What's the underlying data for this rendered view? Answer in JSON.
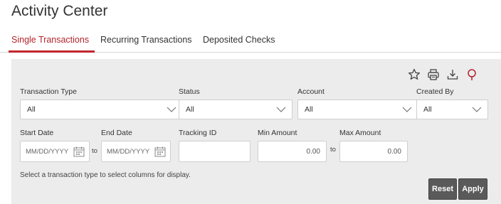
{
  "page": {
    "title": "Activity Center"
  },
  "tabs": [
    {
      "label": "Single Transactions",
      "active": true
    },
    {
      "label": "Recurring Transactions",
      "active": false
    },
    {
      "label": "Deposited Checks",
      "active": false
    }
  ],
  "toolbar": {
    "icons": [
      "star-icon",
      "print-icon",
      "download-icon",
      "search-icon"
    ]
  },
  "filters": {
    "transaction_type": {
      "label": "Transaction Type",
      "value": "All"
    },
    "status": {
      "label": "Status",
      "value": "All"
    },
    "account": {
      "label": "Account",
      "value": "All"
    },
    "created_by": {
      "label": "Created By",
      "value": "All"
    },
    "start_date": {
      "label": "Start Date",
      "placeholder": "MM/DD/YYYY"
    },
    "end_date": {
      "label": "End Date",
      "placeholder": "MM/DD/YYYY"
    },
    "date_range_separator": "to",
    "tracking_id": {
      "label": "Tracking ID",
      "value": ""
    },
    "min_amount": {
      "label": "Min Amount",
      "value": "0.00"
    },
    "max_amount": {
      "label": "Max Amount",
      "value": "0.00"
    },
    "amount_range_separator": "to"
  },
  "hint": "Select a transaction type to select columns for display.",
  "actions": {
    "reset_label": "Reset",
    "apply_label": "Apply"
  },
  "colors": {
    "accent": "#c2262e",
    "panel_bg": "#ececec",
    "button_bg": "#5a5a5a"
  }
}
